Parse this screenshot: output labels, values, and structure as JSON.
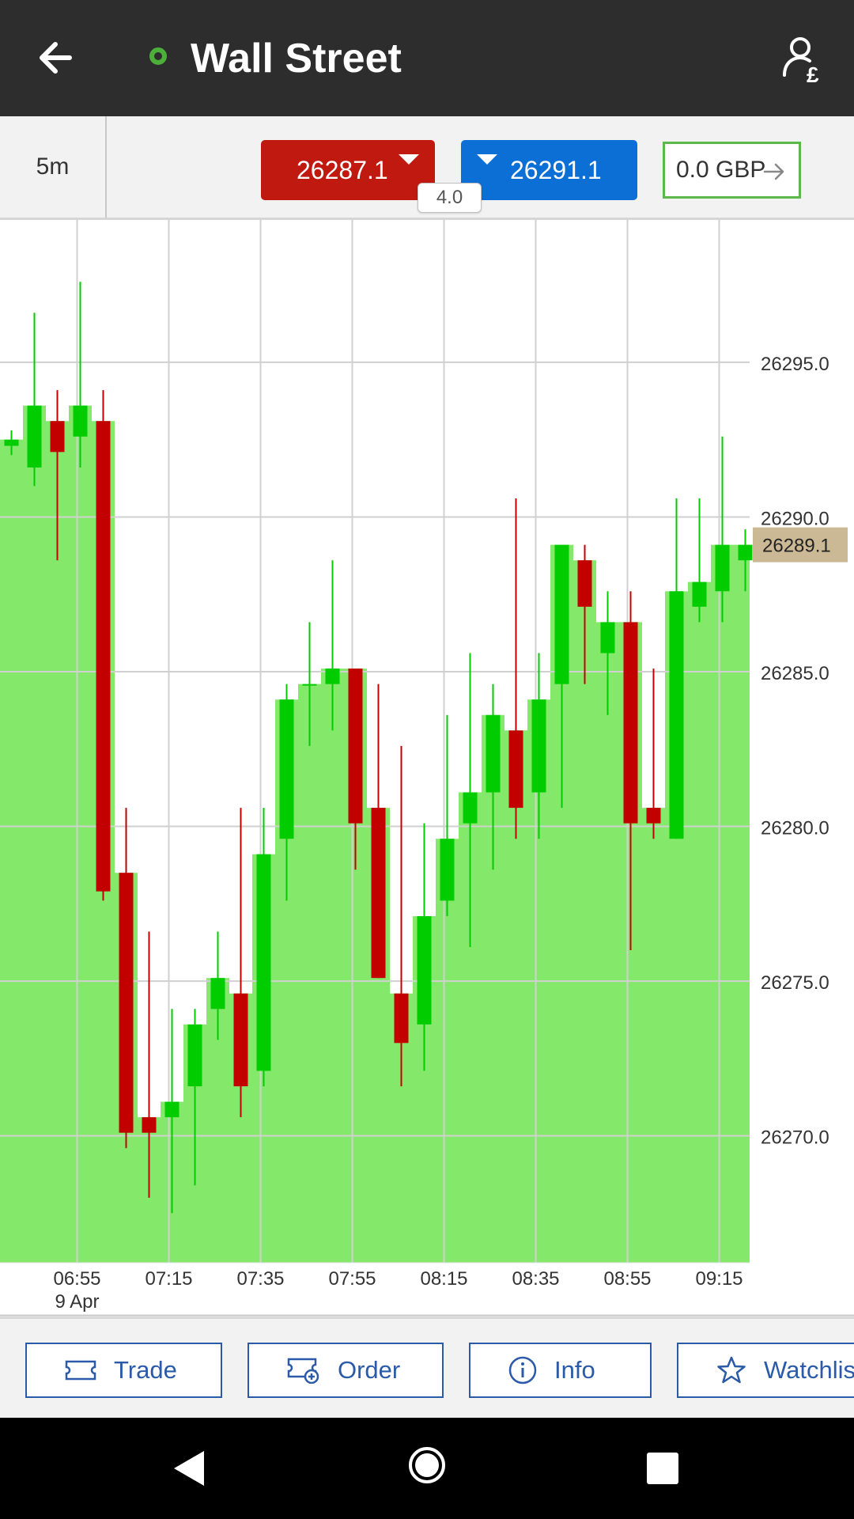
{
  "header": {
    "back_icon": "arrow-left-icon",
    "title": "Wall Street",
    "status_color": "#4caf3a",
    "account_icon": "user-pound-icon"
  },
  "pricebar": {
    "timeframe": "5m",
    "sell_price": "26287.1",
    "buy_price": "26291.1",
    "spread": "4.0",
    "pl_value": "0.0 GBP",
    "colors": {
      "sell": "#c0190f",
      "buy": "#0b6fd6",
      "pl_border": "#5cb84a"
    }
  },
  "chart_data": {
    "type": "candlestick",
    "instrument": "Wall Street",
    "interval": "5m",
    "y_tick_labels": [
      "26295.0",
      "26290.0",
      "26285.0",
      "26280.0",
      "26275.0",
      "26270.0"
    ],
    "y_ticks": [
      26295,
      26290,
      26285,
      26280,
      26275,
      26270
    ],
    "ylim": [
      26265.9,
      26299.6
    ],
    "x_tick_labels": [
      "06:55",
      "07:15",
      "07:35",
      "07:55",
      "08:15",
      "08:35",
      "08:55",
      "09:15"
    ],
    "x_tick_sublabel": "9 Apr",
    "current_price_label": "26289.1",
    "current_price": 26289.1,
    "colors": {
      "up": "#00cc00",
      "down": "#c20000",
      "area": "#84e96a",
      "grid": "#d0d0d0",
      "price_tag": "#cbb995"
    },
    "candles": [
      {
        "o": 26292.3,
        "h": 26292.8,
        "l": 26292.0,
        "c": 26292.5
      },
      {
        "o": 26291.6,
        "h": 26296.6,
        "l": 26291.0,
        "c": 26293.6
      },
      {
        "o": 26293.1,
        "h": 26294.1,
        "l": 26288.6,
        "c": 26292.1
      },
      {
        "o": 26292.6,
        "h": 26297.6,
        "l": 26291.6,
        "c": 26293.6
      },
      {
        "o": 26293.1,
        "h": 26294.1,
        "l": 26277.6,
        "c": 26277.9
      },
      {
        "o": 26278.5,
        "h": 26280.6,
        "l": 26269.6,
        "c": 26270.1
      },
      {
        "o": 26270.6,
        "h": 26276.6,
        "l": 26268.0,
        "c": 26270.1
      },
      {
        "o": 26270.6,
        "h": 26274.1,
        "l": 26267.5,
        "c": 26271.1
      },
      {
        "o": 26271.6,
        "h": 26274.1,
        "l": 26268.4,
        "c": 26273.6
      },
      {
        "o": 26274.1,
        "h": 26276.6,
        "l": 26273.1,
        "c": 26275.1
      },
      {
        "o": 26274.6,
        "h": 26280.6,
        "l": 26270.6,
        "c": 26271.6
      },
      {
        "o": 26272.1,
        "h": 26280.6,
        "l": 26271.6,
        "c": 26279.1
      },
      {
        "o": 26279.6,
        "h": 26284.6,
        "l": 26277.6,
        "c": 26284.1
      },
      {
        "o": 26284.6,
        "h": 26286.6,
        "l": 26282.6,
        "c": 26284.6
      },
      {
        "o": 26284.6,
        "h": 26288.6,
        "l": 26283.1,
        "c": 26285.1
      },
      {
        "o": 26285.1,
        "h": 26285.1,
        "l": 26278.6,
        "c": 26280.1
      },
      {
        "o": 26280.6,
        "h": 26284.6,
        "l": 26275.1,
        "c": 26275.1
      },
      {
        "o": 26274.6,
        "h": 26282.6,
        "l": 26271.6,
        "c": 26273.0
      },
      {
        "o": 26273.6,
        "h": 26280.1,
        "l": 26272.1,
        "c": 26277.1
      },
      {
        "o": 26277.6,
        "h": 26283.6,
        "l": 26277.1,
        "c": 26279.6
      },
      {
        "o": 26280.1,
        "h": 26285.6,
        "l": 26276.1,
        "c": 26281.1
      },
      {
        "o": 26281.1,
        "h": 26284.6,
        "l": 26278.6,
        "c": 26283.6
      },
      {
        "o": 26283.1,
        "h": 26290.6,
        "l": 26279.6,
        "c": 26280.6
      },
      {
        "o": 26281.1,
        "h": 26285.6,
        "l": 26279.6,
        "c": 26284.1
      },
      {
        "o": 26284.6,
        "h": 26285.6,
        "l": 26280.6,
        "c": 26289.1
      },
      {
        "o": 26288.6,
        "h": 26289.1,
        "l": 26284.6,
        "c": 26287.1
      },
      {
        "o": 26285.6,
        "h": 26287.6,
        "l": 26283.6,
        "c": 26286.6
      },
      {
        "o": 26286.6,
        "h": 26287.6,
        "l": 26276.0,
        "c": 26280.1
      },
      {
        "o": 26280.6,
        "h": 26285.1,
        "l": 26279.6,
        "c": 26280.1
      },
      {
        "o": 26279.6,
        "h": 26290.6,
        "l": 26279.6,
        "c": 26287.6
      },
      {
        "o": 26287.1,
        "h": 26290.6,
        "l": 26286.6,
        "c": 26287.9
      },
      {
        "o": 26287.6,
        "h": 26292.6,
        "l": 26286.6,
        "c": 26289.1
      },
      {
        "o": 26288.6,
        "h": 26289.6,
        "l": 26287.6,
        "c": 26289.1
      }
    ]
  },
  "actions": [
    {
      "label": "Trade",
      "icon": "ticket-icon"
    },
    {
      "label": "Order",
      "icon": "order-ticket-icon"
    },
    {
      "label": "Info",
      "icon": "info-icon"
    },
    {
      "label": "Watchlist",
      "icon": "star-icon"
    }
  ],
  "navbar": {
    "back_icon": "nav-back-icon",
    "home_icon": "nav-home-icon",
    "recent_icon": "nav-recent-icon"
  }
}
